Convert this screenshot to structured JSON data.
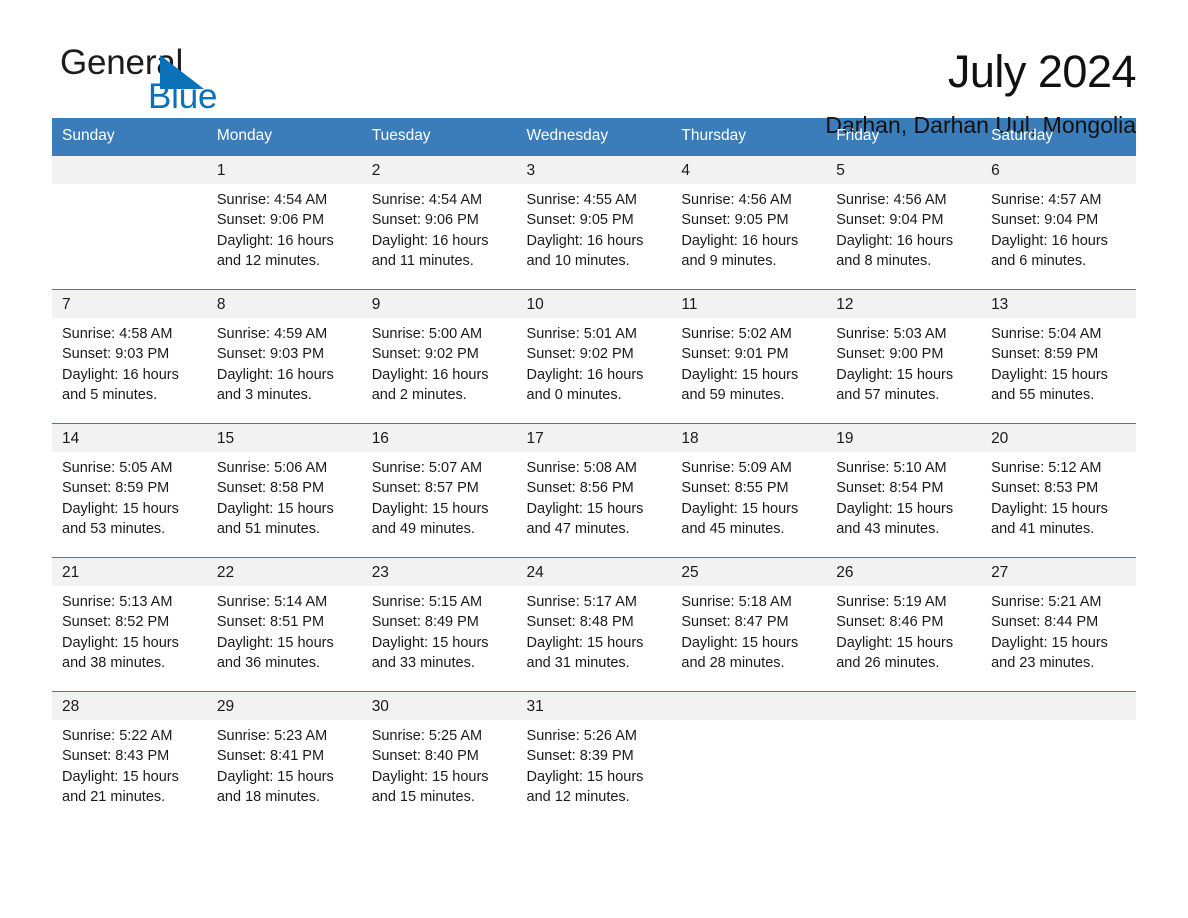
{
  "brand": {
    "word_one": "General",
    "word_two": "Blue",
    "triangle_color": "#0b72b9",
    "blue_color": "#0b72b9"
  },
  "header": {
    "title": "July 2024",
    "subtitle": "Darhan, Darhan Uul, Mongolia"
  },
  "calendar": {
    "accent_color": "#3a7dba",
    "daynum_bg": "#f2f2f2",
    "weekday_headers": [
      "Sunday",
      "Monday",
      "Tuesday",
      "Wednesday",
      "Thursday",
      "Friday",
      "Saturday"
    ],
    "labels": {
      "sunrise_prefix": "Sunrise:",
      "sunset_prefix": "Sunset:",
      "daylight_prefix": "Daylight:"
    },
    "weeks": [
      [
        {
          "day": "",
          "sunrise": "",
          "sunset": "",
          "daylight": "",
          "empty": true
        },
        {
          "day": "1",
          "sunrise": "Sunrise: 4:54 AM",
          "sunset": "Sunset: 9:06 PM",
          "daylight": "Daylight: 16 hours and 12 minutes."
        },
        {
          "day": "2",
          "sunrise": "Sunrise: 4:54 AM",
          "sunset": "Sunset: 9:06 PM",
          "daylight": "Daylight: 16 hours and 11 minutes."
        },
        {
          "day": "3",
          "sunrise": "Sunrise: 4:55 AM",
          "sunset": "Sunset: 9:05 PM",
          "daylight": "Daylight: 16 hours and 10 minutes."
        },
        {
          "day": "4",
          "sunrise": "Sunrise: 4:56 AM",
          "sunset": "Sunset: 9:05 PM",
          "daylight": "Daylight: 16 hours and 9 minutes."
        },
        {
          "day": "5",
          "sunrise": "Sunrise: 4:56 AM",
          "sunset": "Sunset: 9:04 PM",
          "daylight": "Daylight: 16 hours and 8 minutes."
        },
        {
          "day": "6",
          "sunrise": "Sunrise: 4:57 AM",
          "sunset": "Sunset: 9:04 PM",
          "daylight": "Daylight: 16 hours and 6 minutes."
        }
      ],
      [
        {
          "day": "7",
          "sunrise": "Sunrise: 4:58 AM",
          "sunset": "Sunset: 9:03 PM",
          "daylight": "Daylight: 16 hours and 5 minutes."
        },
        {
          "day": "8",
          "sunrise": "Sunrise: 4:59 AM",
          "sunset": "Sunset: 9:03 PM",
          "daylight": "Daylight: 16 hours and 3 minutes."
        },
        {
          "day": "9",
          "sunrise": "Sunrise: 5:00 AM",
          "sunset": "Sunset: 9:02 PM",
          "daylight": "Daylight: 16 hours and 2 minutes."
        },
        {
          "day": "10",
          "sunrise": "Sunrise: 5:01 AM",
          "sunset": "Sunset: 9:02 PM",
          "daylight": "Daylight: 16 hours and 0 minutes."
        },
        {
          "day": "11",
          "sunrise": "Sunrise: 5:02 AM",
          "sunset": "Sunset: 9:01 PM",
          "daylight": "Daylight: 15 hours and 59 minutes."
        },
        {
          "day": "12",
          "sunrise": "Sunrise: 5:03 AM",
          "sunset": "Sunset: 9:00 PM",
          "daylight": "Daylight: 15 hours and 57 minutes."
        },
        {
          "day": "13",
          "sunrise": "Sunrise: 5:04 AM",
          "sunset": "Sunset: 8:59 PM",
          "daylight": "Daylight: 15 hours and 55 minutes."
        }
      ],
      [
        {
          "day": "14",
          "sunrise": "Sunrise: 5:05 AM",
          "sunset": "Sunset: 8:59 PM",
          "daylight": "Daylight: 15 hours and 53 minutes."
        },
        {
          "day": "15",
          "sunrise": "Sunrise: 5:06 AM",
          "sunset": "Sunset: 8:58 PM",
          "daylight": "Daylight: 15 hours and 51 minutes."
        },
        {
          "day": "16",
          "sunrise": "Sunrise: 5:07 AM",
          "sunset": "Sunset: 8:57 PM",
          "daylight": "Daylight: 15 hours and 49 minutes."
        },
        {
          "day": "17",
          "sunrise": "Sunrise: 5:08 AM",
          "sunset": "Sunset: 8:56 PM",
          "daylight": "Daylight: 15 hours and 47 minutes."
        },
        {
          "day": "18",
          "sunrise": "Sunrise: 5:09 AM",
          "sunset": "Sunset: 8:55 PM",
          "daylight": "Daylight: 15 hours and 45 minutes."
        },
        {
          "day": "19",
          "sunrise": "Sunrise: 5:10 AM",
          "sunset": "Sunset: 8:54 PM",
          "daylight": "Daylight: 15 hours and 43 minutes."
        },
        {
          "day": "20",
          "sunrise": "Sunrise: 5:12 AM",
          "sunset": "Sunset: 8:53 PM",
          "daylight": "Daylight: 15 hours and 41 minutes."
        }
      ],
      [
        {
          "day": "21",
          "sunrise": "Sunrise: 5:13 AM",
          "sunset": "Sunset: 8:52 PM",
          "daylight": "Daylight: 15 hours and 38 minutes."
        },
        {
          "day": "22",
          "sunrise": "Sunrise: 5:14 AM",
          "sunset": "Sunset: 8:51 PM",
          "daylight": "Daylight: 15 hours and 36 minutes."
        },
        {
          "day": "23",
          "sunrise": "Sunrise: 5:15 AM",
          "sunset": "Sunset: 8:49 PM",
          "daylight": "Daylight: 15 hours and 33 minutes."
        },
        {
          "day": "24",
          "sunrise": "Sunrise: 5:17 AM",
          "sunset": "Sunset: 8:48 PM",
          "daylight": "Daylight: 15 hours and 31 minutes."
        },
        {
          "day": "25",
          "sunrise": "Sunrise: 5:18 AM",
          "sunset": "Sunset: 8:47 PM",
          "daylight": "Daylight: 15 hours and 28 minutes."
        },
        {
          "day": "26",
          "sunrise": "Sunrise: 5:19 AM",
          "sunset": "Sunset: 8:46 PM",
          "daylight": "Daylight: 15 hours and 26 minutes."
        },
        {
          "day": "27",
          "sunrise": "Sunrise: 5:21 AM",
          "sunset": "Sunset: 8:44 PM",
          "daylight": "Daylight: 15 hours and 23 minutes."
        }
      ],
      [
        {
          "day": "28",
          "sunrise": "Sunrise: 5:22 AM",
          "sunset": "Sunset: 8:43 PM",
          "daylight": "Daylight: 15 hours and 21 minutes."
        },
        {
          "day": "29",
          "sunrise": "Sunrise: 5:23 AM",
          "sunset": "Sunset: 8:41 PM",
          "daylight": "Daylight: 15 hours and 18 minutes."
        },
        {
          "day": "30",
          "sunrise": "Sunrise: 5:25 AM",
          "sunset": "Sunset: 8:40 PM",
          "daylight": "Daylight: 15 hours and 15 minutes."
        },
        {
          "day": "31",
          "sunrise": "Sunrise: 5:26 AM",
          "sunset": "Sunset: 8:39 PM",
          "daylight": "Daylight: 15 hours and 12 minutes."
        },
        {
          "day": "",
          "sunrise": "",
          "sunset": "",
          "daylight": "",
          "empty": true
        },
        {
          "day": "",
          "sunrise": "",
          "sunset": "",
          "daylight": "",
          "empty": true
        },
        {
          "day": "",
          "sunrise": "",
          "sunset": "",
          "daylight": "",
          "empty": true
        }
      ]
    ]
  }
}
